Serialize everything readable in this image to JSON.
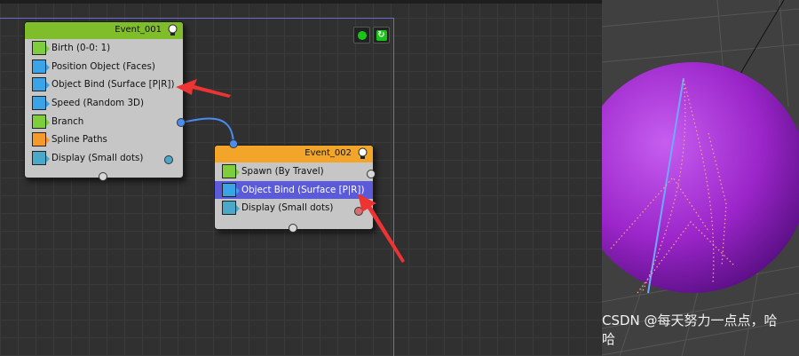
{
  "colors": {
    "event1_header": "#7fbd2a",
    "event2_header": "#f3a52a",
    "selected_row": "#5b5bd9",
    "node_body": "#c6c6c6",
    "wire": "#4a8cf0",
    "sphere": "#9b25c9",
    "arrow": "#ee3333"
  },
  "toolbar": {
    "icons": [
      "green-dot-icon",
      "refresh-icon"
    ]
  },
  "event1": {
    "title": "Event_001",
    "ops": [
      {
        "label": "Birth (0-0: 1)",
        "icon": "birth-icon",
        "color": "#7fcd3a"
      },
      {
        "label": "Position Object (Faces)",
        "icon": "position-object-icon",
        "color": "#3aa4e6"
      },
      {
        "label": "Object Bind (Surface [P|R])",
        "icon": "object-bind-icon",
        "color": "#3aa4e6"
      },
      {
        "label": "Speed (Random 3D)",
        "icon": "speed-icon",
        "color": "#3aa4e6"
      },
      {
        "label": "Branch",
        "icon": "branch-icon",
        "color": "#7fcd3a"
      },
      {
        "label": "Spline Paths",
        "icon": "spline-paths-icon",
        "color": "#f39a2a"
      },
      {
        "label": "Display (Small dots)",
        "icon": "display-icon",
        "color": "#4aa9c9"
      }
    ]
  },
  "event2": {
    "title": "Event_002",
    "ops": [
      {
        "label": "Spawn (By Travel)",
        "icon": "spawn-icon",
        "color": "#7fcd3a"
      },
      {
        "label": "Object Bind (Surface [P|R])",
        "icon": "object-bind-icon",
        "color": "#3aa4e6"
      },
      {
        "label": "Display (Small dots)",
        "icon": "display-icon",
        "color": "#4aa9c9"
      }
    ]
  },
  "watermark": "CSDN @每天努力一点点，哈哈"
}
